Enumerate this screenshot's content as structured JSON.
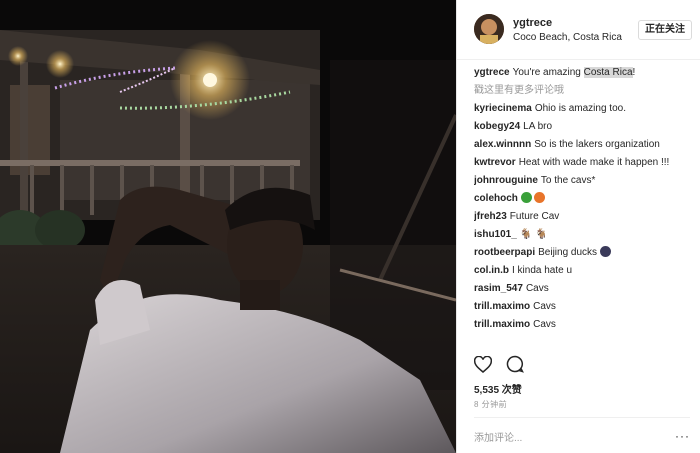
{
  "header": {
    "username": "ygtrece",
    "location": "Coco Beach, Costa Rica",
    "follow_label": "正在关注"
  },
  "caption": {
    "user": "ygtrece",
    "text_before": "You're amazing ",
    "text_highlight": "Costa Rica",
    "text_after": "!"
  },
  "more_comments_label": "戳这里有更多评论哦",
  "comments": [
    {
      "user": "kyriecinema",
      "text": "Ohio is amazing too."
    },
    {
      "user": "kobegy24",
      "text": "LA bro"
    },
    {
      "user": "alex.winnnn",
      "text": "So is the lakers organization"
    },
    {
      "user": "kwtrevor",
      "text": "Heat with wade make it happen !!!"
    },
    {
      "user": "johnrouguine",
      "text": "To the cavs*"
    },
    {
      "user": "colehoch",
      "text": ""
    },
    {
      "user": "jfreh23",
      "text": "Future Cav"
    },
    {
      "user": "ishu101_",
      "text": "🐐 🐐"
    },
    {
      "user": "rootbeerpapi",
      "text": "Beijing ducks"
    },
    {
      "user": "col.in.b",
      "text": "I kinda hate u"
    },
    {
      "user": "rasim_547",
      "text": "Cavs"
    },
    {
      "user": "trill.maximo",
      "text": "Cavs"
    },
    {
      "user": "trill.maximo",
      "text": "Cavs"
    }
  ],
  "likes_label": "5,535 次赞",
  "time_label": "8 分钟前",
  "add_comment_placeholder": "添加评论...",
  "more_options": "···",
  "colors": {
    "text": "#262626",
    "muted": "#999999",
    "border": "#efefef",
    "basketball": "#e8742a",
    "clover": "#3aa03a"
  },
  "icons": {
    "like": "heart-icon",
    "comment": "comment-bubble-icon"
  }
}
